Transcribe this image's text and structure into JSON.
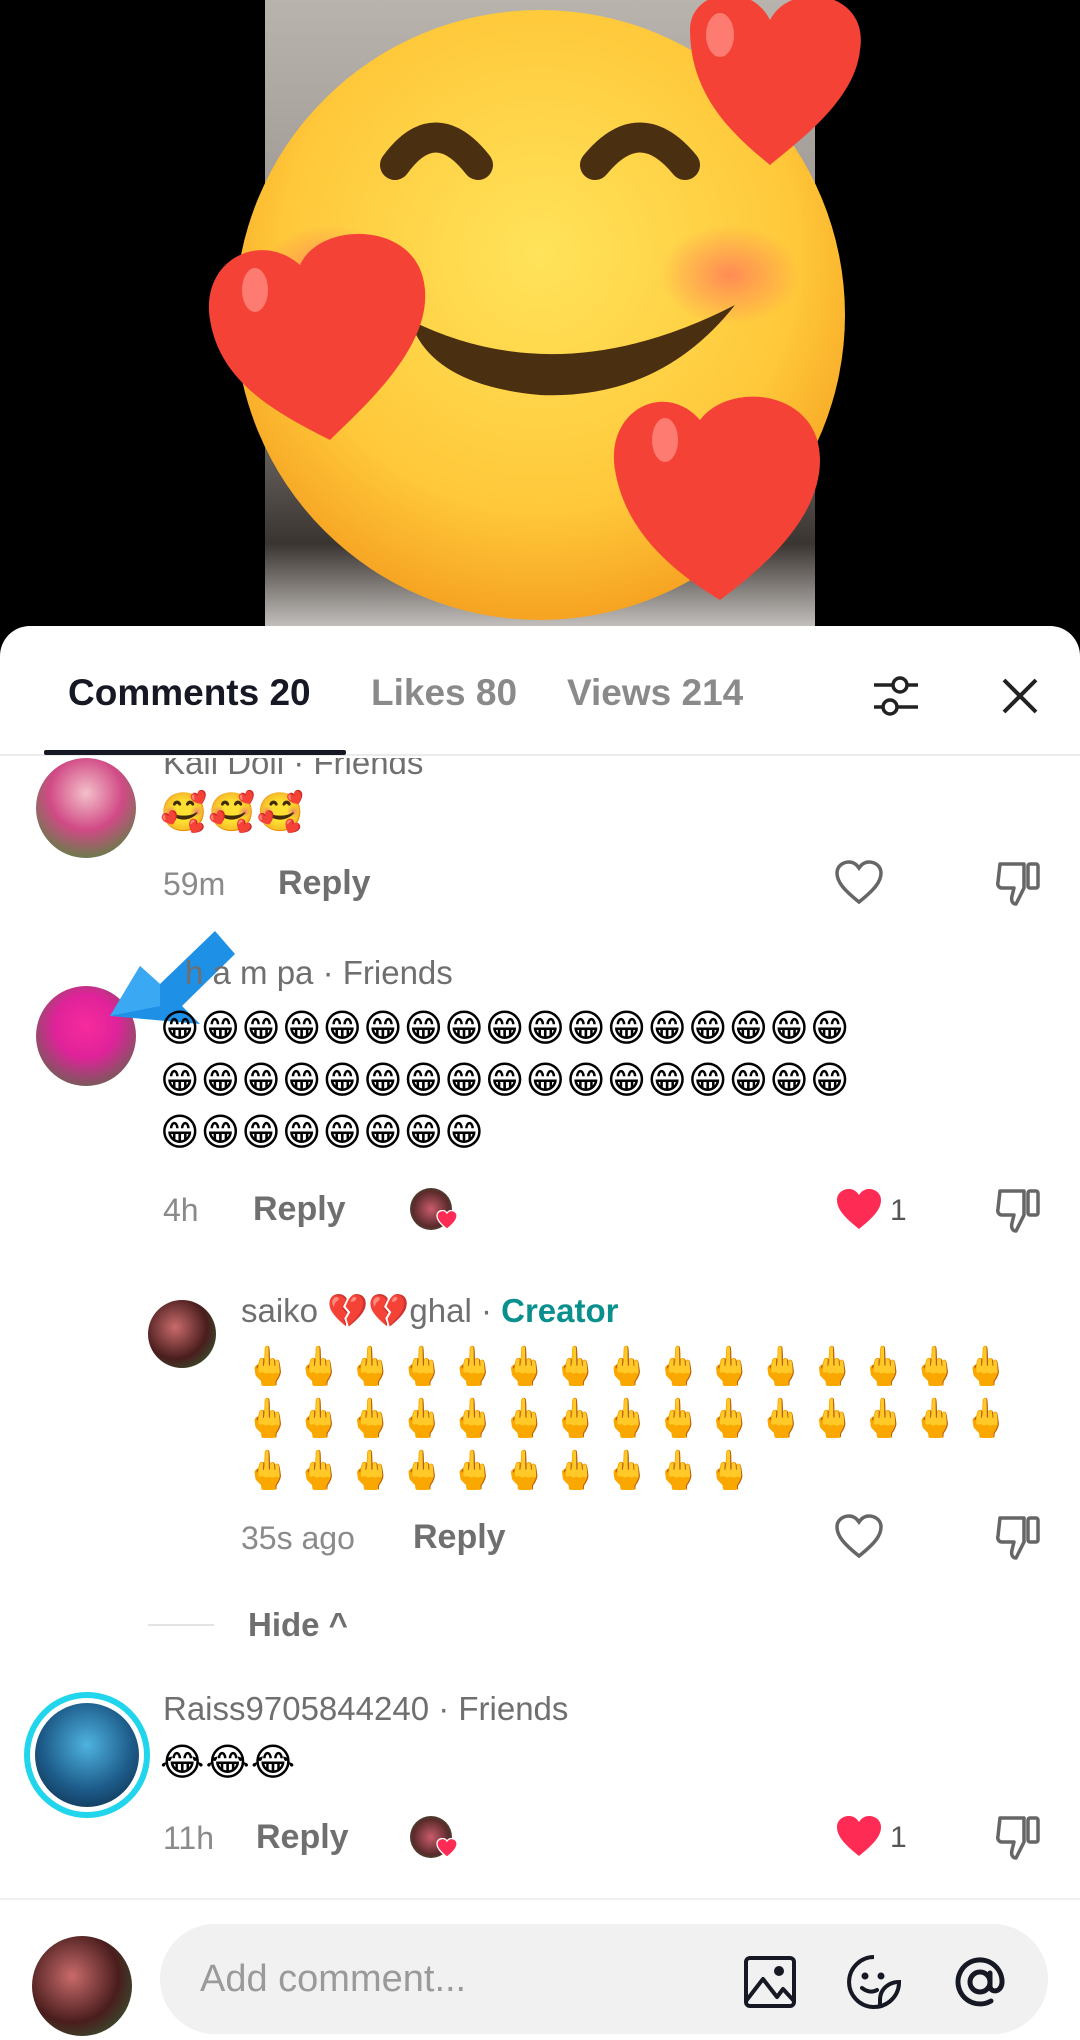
{
  "tabs": [
    {
      "label": "Comments 20"
    },
    {
      "label": "Likes 80"
    },
    {
      "label": "Views 214"
    }
  ],
  "comments": [
    {
      "name": "Kali Doll · Friends",
      "text": "🥰🥰🥰",
      "time": "59m",
      "reply_label": "Reply",
      "liked": false
    },
    {
      "name": "h a m pa · Friends",
      "lines": [
        "😁😁😁😁😁😁😁😁😁😁😁😁😁😁😁😁😁",
        "😁😁😁😁😁😁😁😁😁😁😁😁😁😁😁😁😁",
        "😁😁😁😁😁😁😁😁"
      ],
      "time": "4h",
      "reply_label": "Reply",
      "liked": true,
      "like_count": "1"
    },
    {
      "name_prefix": "saiko 💔💔ghal · ",
      "badge": "Creator",
      "lines": [
        "🖕🖕🖕🖕🖕🖕🖕🖕🖕🖕🖕🖕🖕🖕🖕",
        "🖕🖕🖕🖕🖕🖕🖕🖕🖕🖕🖕🖕🖕🖕🖕",
        "🖕🖕🖕🖕🖕🖕🖕🖕🖕🖕"
      ],
      "time": "35s ago",
      "reply_label": "Reply",
      "liked": false
    },
    {
      "name": "Raiss9705844240 · Friends",
      "text": "😂😂😂",
      "time": "11h",
      "reply_label": "Reply",
      "liked": true,
      "like_count": "1"
    }
  ],
  "hide_label": "Hide ^",
  "composer": {
    "placeholder": "Add comment..."
  },
  "colors": {
    "heart_red": "#fe2c55",
    "creator_teal": "#0a8f8f",
    "story_ring": "#20d5ec"
  },
  "icons": [
    "filter-icon",
    "close-icon",
    "heart-outline-icon",
    "heart-filled-icon",
    "dislike-icon",
    "image-icon",
    "sticker-icon",
    "mention-icon"
  ]
}
